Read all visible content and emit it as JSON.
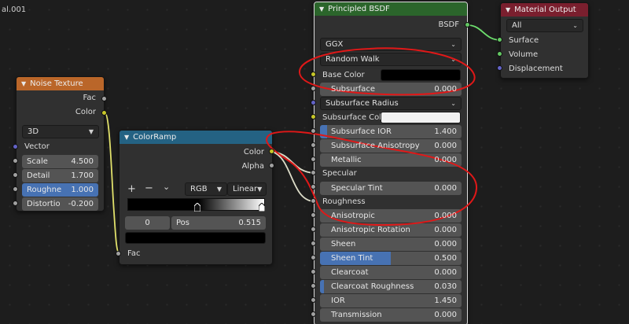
{
  "editor": {
    "corner_label": "al.001"
  },
  "colors": {
    "header_texture": "#ba6629",
    "header_converter": "#246283",
    "header_shader": "#2b652b",
    "header_output": "#7a1f2e",
    "socket_gray": "#a1a1a1",
    "socket_yellow": "#c7c729",
    "socket_purple": "#6363c7",
    "socket_green": "#63c763",
    "field_accent": "#4772b3",
    "annotation_red": "#e01818"
  },
  "noise": {
    "title": "Noise Texture",
    "out_fac": "Fac",
    "out_color": "Color",
    "dimension": "3D",
    "in_vector": "Vector",
    "scale_label": "Scale",
    "scale_value": "4.500",
    "detail_label": "Detail",
    "detail_value": "1.700",
    "rough_label": "Roughne",
    "rough_value": "1.000",
    "distort_label": "Distortio",
    "distort_value": "-0.200"
  },
  "ramp": {
    "title": "ColorRamp",
    "out_color": "Color",
    "out_alpha": "Alpha",
    "add": "+",
    "remove": "−",
    "menu": "⌄",
    "color_mode": "RGB",
    "interpolation": "Linear",
    "stop_index": "0",
    "pos_label": "Pos",
    "pos_value": "0.515",
    "in_fac": "Fac"
  },
  "bsdf": {
    "title": "Principled BSDF",
    "out_bsdf": "BSDF",
    "distribution": "GGX",
    "subsurface_method": "Random Walk",
    "base_color": "Base Color",
    "subsurface_label": "Subsurface",
    "subsurface_value": "0.000",
    "subsurface_radius": "Subsurface Radius",
    "subsurface_col": "Subsurface Col",
    "ior_sss_label": "Subsurface IOR",
    "ior_sss_value": "1.400",
    "aniso_sss_label": "Subsurface Anisotropy",
    "aniso_sss_value": "0.000",
    "metallic_label": "Metallic",
    "metallic_value": "0.000",
    "specular": "Specular",
    "spec_tint_label": "Specular Tint",
    "spec_tint_value": "0.000",
    "roughness": "Roughness",
    "anisotropic_label": "Anisotropic",
    "anisotropic_value": "0.000",
    "aniso_rot_label": "Anisotropic Rotation",
    "aniso_rot_value": "0.000",
    "sheen_label": "Sheen",
    "sheen_value": "0.000",
    "sheen_tint_label": "Sheen Tint",
    "sheen_tint_value": "0.500",
    "clearcoat_label": "Clearcoat",
    "clearcoat_value": "0.000",
    "cc_rough_label": "Clearcoat Roughness",
    "cc_rough_value": "0.030",
    "ior_label": "IOR",
    "ior_value": "1.450",
    "transmission_label": "Transmission",
    "transmission_value": "0.000"
  },
  "output": {
    "title": "Material Output",
    "target": "All",
    "surface": "Surface",
    "volume": "Volume",
    "displacement": "Displacement"
  }
}
